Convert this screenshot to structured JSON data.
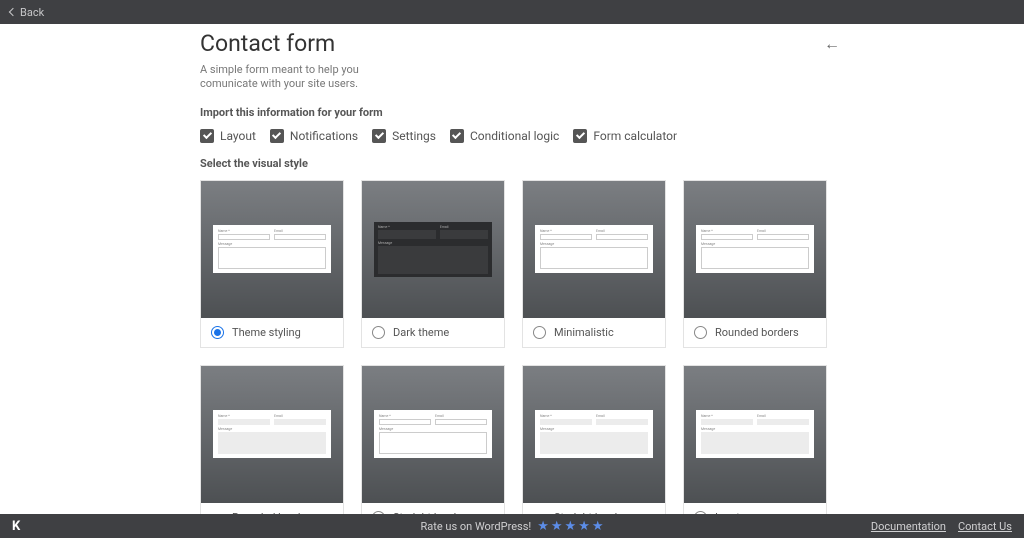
{
  "topbar": {
    "back_label": "Back"
  },
  "header": {
    "title": "Contact form",
    "subtitle": "A simple form meant to help you comunicate with your site users."
  },
  "sections": {
    "import_label": "Import this information for your form",
    "style_label": "Select the visual style"
  },
  "checks": {
    "layout": "Layout",
    "notifications": "Notifications",
    "settings": "Settings",
    "conditional": "Conditional logic",
    "calculator": "Form calculator"
  },
  "styles": [
    {
      "label": "Theme styling",
      "selected": true,
      "variant": "light"
    },
    {
      "label": "Dark theme",
      "selected": false,
      "variant": "dark"
    },
    {
      "label": "Minimalistic",
      "selected": false,
      "variant": "light"
    },
    {
      "label": "Rounded borders",
      "selected": false,
      "variant": "light"
    },
    {
      "label": "Rounded borders grey",
      "selected": false,
      "variant": "grey"
    },
    {
      "label": "Straight borders",
      "selected": false,
      "variant": "light"
    },
    {
      "label": "Straight borders grey",
      "selected": false,
      "variant": "grey"
    },
    {
      "label": "Input grey",
      "selected": false,
      "variant": "grey"
    }
  ],
  "mini_form": {
    "name": "Name *",
    "email": "Email",
    "message": "Message"
  },
  "footer": {
    "rate_text": "Rate us on WordPress!",
    "links": {
      "docs": "Documentation",
      "contact": "Contact Us"
    }
  }
}
